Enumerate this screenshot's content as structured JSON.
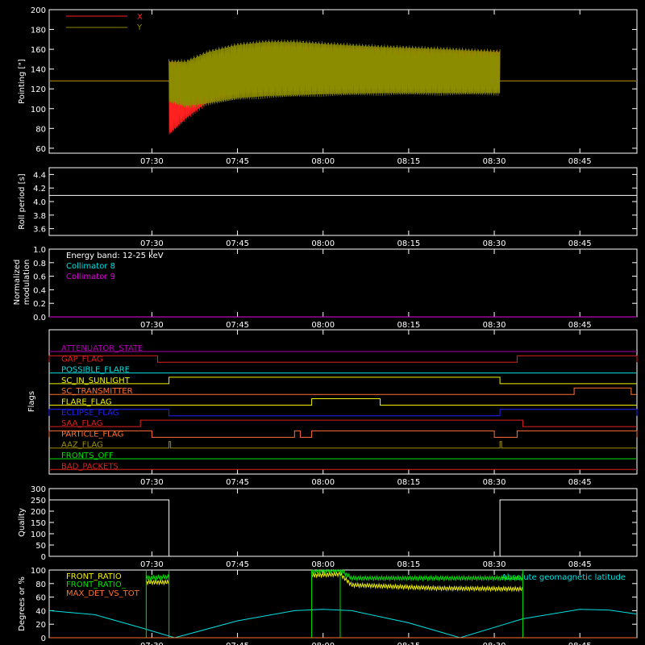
{
  "colors": {
    "background": "#000000",
    "axes": "#ffffff",
    "x_series": "#ff2020",
    "y_series": "#8c8c00",
    "cyan": "#00e0e0",
    "magenta": "#e000e0",
    "red": "#e02020",
    "orange": "#ff7030",
    "yellow": "#f0f000",
    "green": "#00e000",
    "blue": "#2020ff",
    "olive": "#a09000",
    "purple": "#b000b0"
  },
  "time_axis": {
    "range": [
      "07:12",
      "08:55"
    ],
    "ticks": [
      "07:30",
      "07:45",
      "08:00",
      "08:15",
      "08:30",
      "08:45"
    ]
  },
  "chart_data": [
    {
      "id": "pointing",
      "type": "line",
      "ylabel": "Pointing [\"]",
      "ylim": [
        55,
        200
      ],
      "yticks": [
        "60",
        "80",
        "100",
        "120",
        "140",
        "160",
        "180",
        "200"
      ],
      "legend": [
        "X",
        "Y"
      ],
      "legend_position": "top-left",
      "series": [
        {
          "name": "X",
          "color_key": "x_series",
          "baseline": 128,
          "envelope_t": [
            "07:33",
            "07:36",
            "07:40",
            "07:45",
            "07:50",
            "07:55",
            "08:00",
            "08:10",
            "08:20",
            "08:31"
          ],
          "envelope_upper": [
            150,
            147,
            152,
            160,
            165,
            165,
            164,
            162,
            160,
            160
          ],
          "envelope_lower": [
            72,
            88,
            105,
            114,
            120,
            122,
            123,
            124,
            125,
            126
          ]
        },
        {
          "name": "Y",
          "color_key": "y_series",
          "baseline": 128,
          "envelope_t": [
            "07:33",
            "07:36",
            "07:40",
            "07:45",
            "07:50",
            "07:55",
            "08:00",
            "08:10",
            "08:20",
            "08:31"
          ],
          "envelope_upper": [
            150,
            150,
            160,
            167,
            170,
            170,
            168,
            165,
            163,
            160
          ],
          "envelope_lower": [
            105,
            100,
            103,
            108,
            110,
            111,
            112,
            113,
            113,
            113
          ]
        }
      ]
    },
    {
      "id": "roll",
      "type": "line",
      "ylabel": "Roll period [s]",
      "ylim": [
        3.5,
        4.5
      ],
      "yticks": [
        "3.6",
        "3.8",
        "4.0",
        "4.2",
        "4.4"
      ],
      "series": [
        {
          "t": [
            "07:12",
            "08:55"
          ],
          "values": [
            4.09,
            4.09
          ],
          "color_key": "axes"
        }
      ]
    },
    {
      "id": "modulation",
      "type": "line",
      "ylabel": [
        "Normalized",
        "modulation"
      ],
      "ylim": [
        0,
        1.0
      ],
      "yticks": [
        "0.0",
        "0.2",
        "0.4",
        "0.6",
        "0.8",
        "1.0"
      ],
      "annotations": [
        "Energy band: 12-25 keV",
        "Collimator 8",
        "Collimator 9"
      ],
      "series": [
        {
          "t": [
            "07:12",
            "08:55"
          ],
          "values": [
            0.0,
            0.0
          ],
          "color_key": "magenta"
        }
      ]
    },
    {
      "id": "flags",
      "type": "line",
      "ylabel": "Flags",
      "series": [
        {
          "name": "ATTENUATOR_STATE",
          "color_key": "purple",
          "on": []
        },
        {
          "name": "GAP_FLAG",
          "color_key": "red",
          "on": [
            [
              "07:12",
              "07:31"
            ],
            [
              "08:34",
              "08:55"
            ]
          ]
        },
        {
          "name": "POSSIBLE_FLARE",
          "color_key": "cyan",
          "on": []
        },
        {
          "name": "SC_IN_SUNLIGHT",
          "color_key": "yellow",
          "on": [
            [
              "07:33",
              "08:31"
            ]
          ]
        },
        {
          "name": "SC_TRANSMITTER",
          "color_key": "orange",
          "on": [
            [
              "08:44",
              "08:54"
            ]
          ]
        },
        {
          "name": "FLARE_FLAG",
          "color_key": "yellow",
          "on": [
            [
              "07:58",
              "08:10"
            ]
          ]
        },
        {
          "name": "ECLIPSE_FLAG",
          "color_key": "blue",
          "on": [
            [
              "07:12",
              "07:33"
            ],
            [
              "08:31",
              "08:55"
            ]
          ]
        },
        {
          "name": "SAA_FLAG",
          "color_key": "red",
          "on": [
            [
              "07:28",
              "08:35"
            ]
          ]
        },
        {
          "name": "PARTICLE_FLAG",
          "color_key": "orange",
          "on": [
            [
              "07:12",
              "07:30"
            ],
            [
              "07:55",
              "07:56"
            ],
            [
              "07:58",
              "08:30"
            ],
            [
              "08:34",
              "08:55"
            ]
          ]
        },
        {
          "name": "AAZ_FLAG",
          "color_key": "olive",
          "on": [
            [
              "07:33",
              "07:33"
            ],
            [
              "08:31",
              "08:31"
            ]
          ]
        },
        {
          "name": "FRONTS_OFF",
          "color_key": "green",
          "on": []
        },
        {
          "name": "BAD_PACKETS",
          "color_key": "red",
          "on": []
        }
      ]
    },
    {
      "id": "quality",
      "type": "line",
      "ylabel": "Quality",
      "ylim": [
        0,
        300
      ],
      "yticks": [
        "0",
        "50",
        "100",
        "150",
        "200",
        "250",
        "300"
      ],
      "series": [
        {
          "t": [
            "07:12",
            "07:33",
            "07:33",
            "08:31",
            "08:31",
            "08:55"
          ],
          "values": [
            250,
            250,
            0,
            0,
            250,
            250
          ],
          "color_key": "axes"
        }
      ]
    },
    {
      "id": "ratios",
      "type": "line",
      "ylabel": "Degrees or %",
      "ylim": [
        0,
        100
      ],
      "yticks": [
        "0",
        "20",
        "40",
        "60",
        "80",
        "100"
      ],
      "legend": [
        "FRONT_RATIO",
        "FRONT_RATIO_",
        "MAX_DET_VS_TOT"
      ],
      "annotations": [
        "Absolute geomagnetic latitude"
      ],
      "series": [
        {
          "name": "Absolute geomagnetic latitude",
          "color_key": "cyan",
          "t": [
            "07:12",
            "07:20",
            "07:28",
            "07:34",
            "07:45",
            "07:55",
            "08:00",
            "08:05",
            "08:15",
            "08:24",
            "08:35",
            "08:45",
            "08:50",
            "08:55"
          ],
          "values": [
            40,
            34,
            15,
            0,
            25,
            40,
            42,
            40,
            22,
            0,
            28,
            42,
            41,
            35
          ]
        },
        {
          "name": "FRONT_RATIO",
          "color_key": "yellow",
          "t": [
            "07:29",
            "07:33",
            "07:58",
            "08:03",
            "08:05",
            "08:20",
            "08:35"
          ],
          "values": [
            82,
            82,
            92,
            94,
            78,
            73,
            72
          ]
        },
        {
          "name": "FRONT_RATIO_",
          "color_key": "green",
          "t": [
            "07:29",
            "07:33",
            "07:58",
            "08:03",
            "08:05",
            "08:20",
            "08:35"
          ],
          "values": [
            88,
            90,
            98,
            100,
            88,
            88,
            88
          ]
        },
        {
          "name": "MAX_DET_VS_TOT",
          "color_key": "orange",
          "t": [
            "07:12",
            "08:55"
          ],
          "values": [
            0,
            0
          ]
        }
      ]
    }
  ]
}
